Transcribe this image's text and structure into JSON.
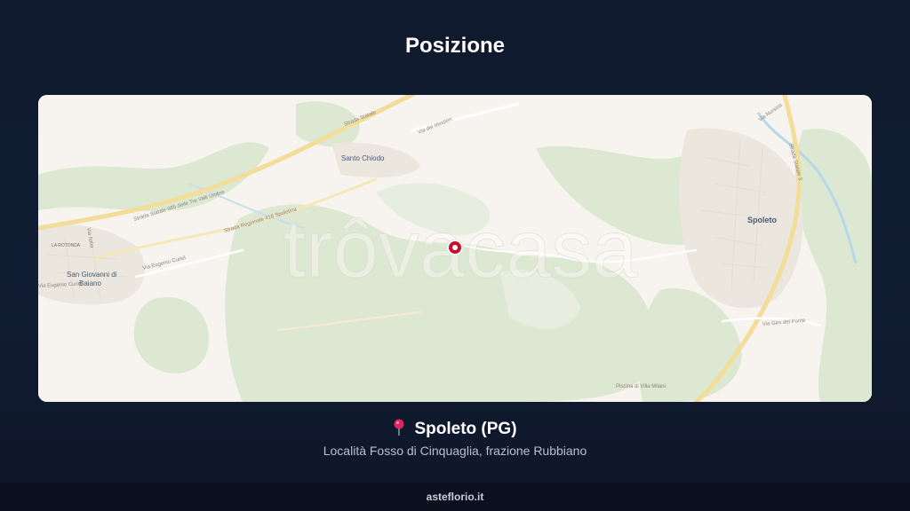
{
  "header": {
    "title": "Posizione"
  },
  "map": {
    "watermark": "trôvacasa",
    "places": [
      {
        "name": "Santo Chiodo",
        "kind": "town"
      },
      {
        "name": "Spoleto",
        "kind": "city"
      },
      {
        "name": "San Giovanni di",
        "kind": "town"
      },
      {
        "name": "Baiano",
        "kind": "town"
      },
      {
        "name": "LA ROTONDA",
        "kind": "locality"
      }
    ],
    "roads": [
      {
        "name": "Strada Statale 685 delle Tre Valli Umbre"
      },
      {
        "name": "Strada Regionale 418 Spoletina"
      },
      {
        "name": "Via Eugenio Curiel"
      },
      {
        "name": "Via del Mestieri"
      },
      {
        "name": "Via Nursina"
      },
      {
        "name": "Strada Statale 3"
      },
      {
        "name": "Via Giro del Ponte"
      },
      {
        "name": "Strada Statale"
      },
      {
        "name": "Via Eugenio Curiel"
      },
      {
        "name": "Via Italia"
      },
      {
        "name": "Piscina di Villa Milani"
      }
    ],
    "marker": {
      "icon": "location-marker-icon",
      "color": "#c8102e"
    },
    "colors": {
      "land": "#f7f4ef",
      "forest": "#dfe9d6",
      "road_major": "#f2dd9b",
      "water": "#b7d8e6"
    }
  },
  "location": {
    "pin_icon": "pushpin-icon",
    "city": "Spoleto (PG)",
    "address": "Località Fosso di Cinquaglia, frazione Rubbiano"
  },
  "footer": {
    "site": "asteflorio.it"
  }
}
